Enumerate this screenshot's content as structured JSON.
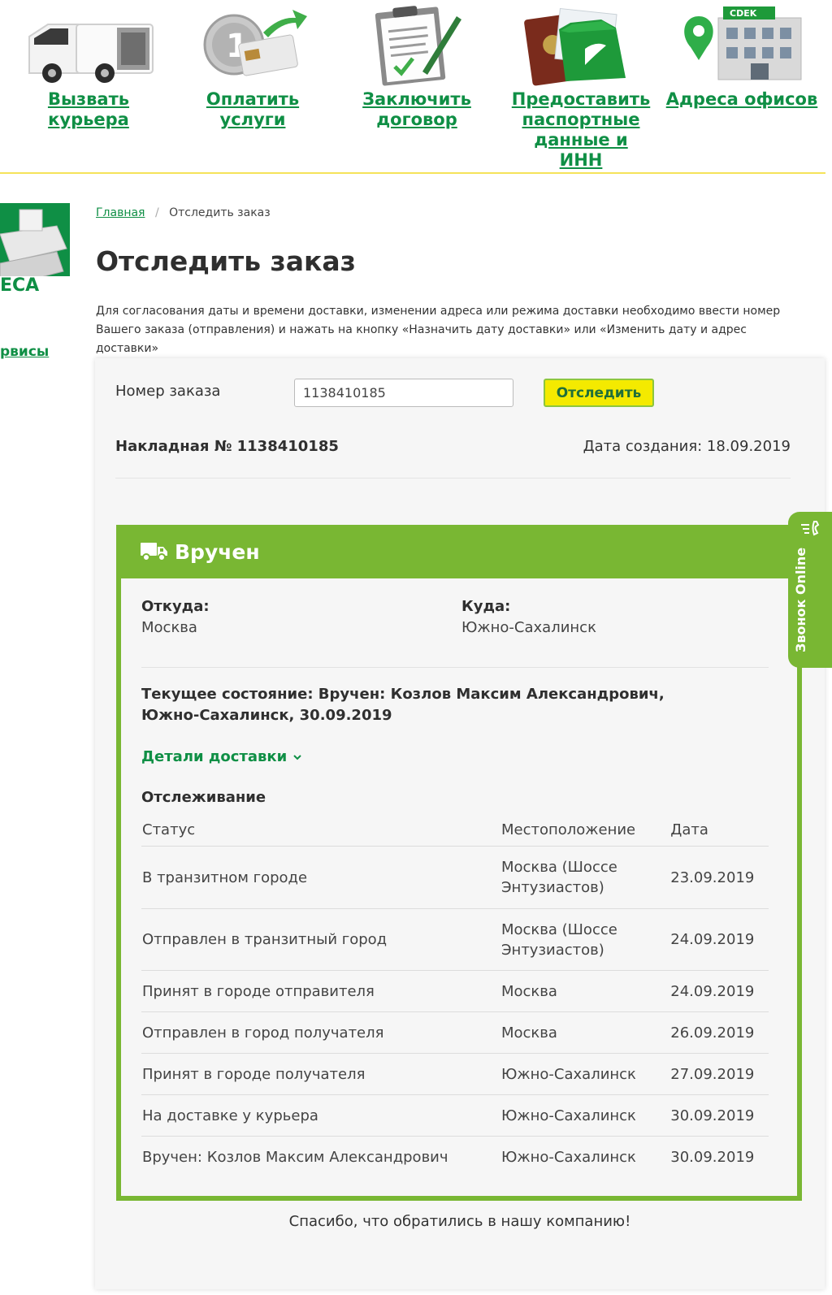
{
  "nav": [
    {
      "label": "Вызвать\nкурьера",
      "icon": "courier-van-icon"
    },
    {
      "label": "Оплатить\nуслуги",
      "icon": "payment-card-icon"
    },
    {
      "label": "Заключить\nдоговор",
      "icon": "contract-clipboard-icon"
    },
    {
      "label": "Предоставить\nпаспортные\nданные и ИНН",
      "icon": "passport-icon"
    },
    {
      "label": "Адреса офисов",
      "icon": "office-building-icon"
    }
  ],
  "office_sign": "CDEK",
  "sidebar": {
    "promo_text": "ЕСА",
    "link": "рвисы"
  },
  "breadcrumb": {
    "home": "Главная",
    "sep": "/",
    "current": "Отследить заказ"
  },
  "page": {
    "title": "Отследить заказ",
    "description": "Для согласования даты и времени доставки, изменении адреса или режима доставки необходимо ввести номер Вашего заказа (отправления) и нажать на кнопку «Назначить дату доставки» или «Изменить дату и адрес доставки»"
  },
  "form": {
    "label": "Номер заказа",
    "value": "1138410185",
    "button": "Отследить"
  },
  "invoice": {
    "number_text": "Накладная № 1138410185",
    "created_text": "Дата создания: 18.09.2019"
  },
  "status": {
    "title": "Вручен",
    "from_label": "Откуда:",
    "from_value": "Москва",
    "to_label": "Куда:",
    "to_value": "Южно-Сахалинск",
    "current": "Текущее состояние: Вручен: Козлов Максим Александрович, Южно-Сахалинск, 30.09.2019",
    "details_link": "Детали доставки",
    "tracking_title": "Отслеживание"
  },
  "table": {
    "headers": [
      "Статус",
      "Местоположение",
      "Дата"
    ],
    "rows": [
      [
        "В транзитном городе",
        "Москва (Шоссе Энтузиастов)",
        "23.09.2019"
      ],
      [
        "Отправлен в транзитный город",
        "Москва (Шоссе Энтузиастов)",
        "24.09.2019"
      ],
      [
        "Принят в городе отправителя",
        "Москва",
        "24.09.2019"
      ],
      [
        "Отправлен в город получателя",
        "Москва",
        "26.09.2019"
      ],
      [
        "Принят в городе получателя",
        "Южно-Сахалинск",
        "27.09.2019"
      ],
      [
        "На доставке у курьера",
        "Южно-Сахалинск",
        "30.09.2019"
      ],
      [
        "Вручен: Козлов Максим Александрович",
        "Южно-Сахалинск",
        "30.09.2019"
      ]
    ]
  },
  "thanks": "Спасибо, что обратились в нашу компанию!",
  "call_widget": "Звонок Online",
  "colors": {
    "brand_green": "#0f8f45",
    "status_green": "#79b733",
    "button_yellow": "#f4ea00"
  }
}
